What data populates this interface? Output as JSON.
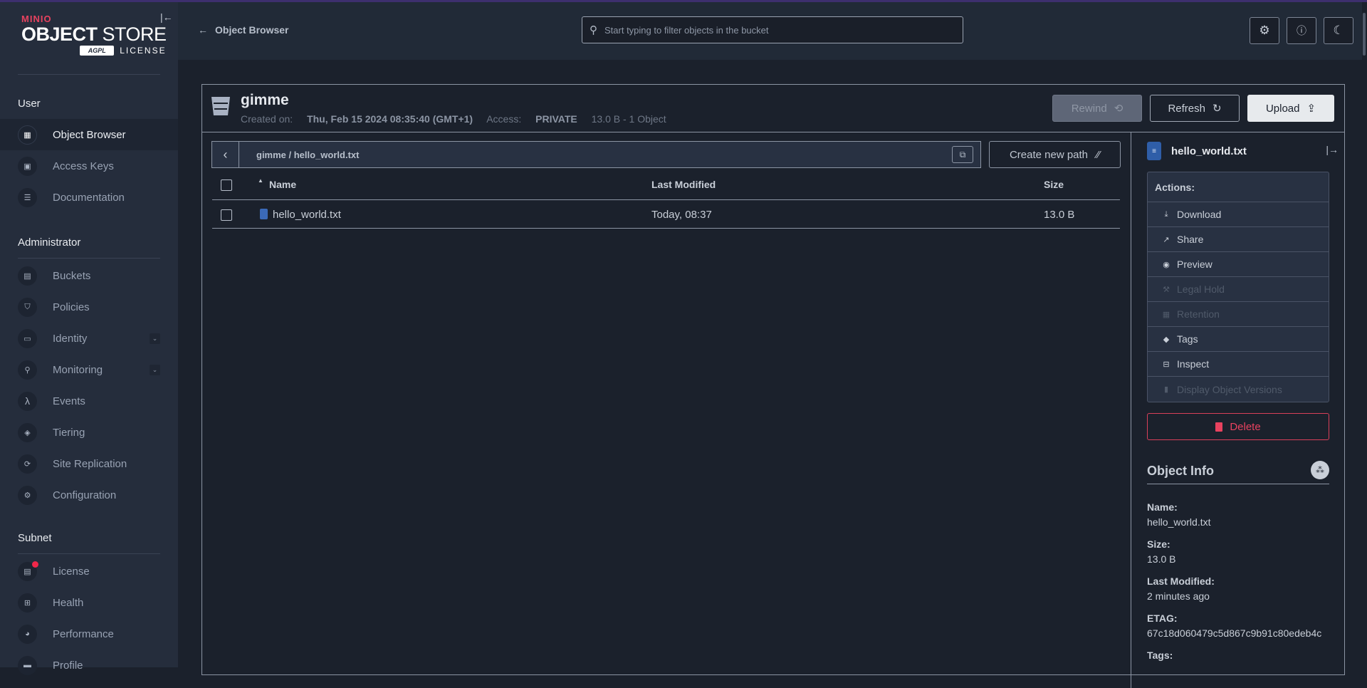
{
  "brand": {
    "minio": "MINIO",
    "product_bold": "OBJECT",
    "product_light": "STORE",
    "agpl": "AGPL",
    "license": "LICENSE"
  },
  "sidebar": {
    "sections": [
      {
        "title": "User",
        "items": [
          {
            "label": "Object Browser",
            "icon": "object-browser-icon",
            "active": true
          },
          {
            "label": "Access Keys",
            "icon": "access-keys-icon"
          },
          {
            "label": "Documentation",
            "icon": "documentation-icon"
          }
        ]
      },
      {
        "title": "Administrator",
        "items": [
          {
            "label": "Buckets",
            "icon": "bucket-icon"
          },
          {
            "label": "Policies",
            "icon": "policies-icon"
          },
          {
            "label": "Identity",
            "icon": "identity-icon",
            "expandable": true
          },
          {
            "label": "Monitoring",
            "icon": "monitoring-icon",
            "expandable": true
          },
          {
            "label": "Events",
            "icon": "lambda-icon"
          },
          {
            "label": "Tiering",
            "icon": "tiering-icon"
          },
          {
            "label": "Site Replication",
            "icon": "site-replication-icon"
          },
          {
            "label": "Configuration",
            "icon": "gear-icon"
          }
        ]
      },
      {
        "title": "Subnet",
        "items": [
          {
            "label": "License",
            "icon": "license-icon",
            "badge": true
          },
          {
            "label": "Health",
            "icon": "health-icon"
          },
          {
            "label": "Performance",
            "icon": "performance-icon"
          },
          {
            "label": "Profile",
            "icon": "profile-icon"
          }
        ]
      }
    ]
  },
  "topbar": {
    "back_label": "Object Browser",
    "search_placeholder": "Start typing to filter objects in the bucket",
    "search_value": ""
  },
  "bucket": {
    "name": "gimme",
    "created_label": "Created on:",
    "created_value": "Thu, Feb 15 2024 08:35:40 (GMT+1)",
    "access_label": "Access:",
    "access_value": "PRIVATE",
    "summary": "13.0 B - 1 Object",
    "buttons": {
      "rewind": "Rewind",
      "refresh": "Refresh",
      "upload": "Upload"
    }
  },
  "browser": {
    "path": "gimme / hello_world.txt",
    "create_path_label": "Create new path",
    "columns": [
      "Name",
      "Last Modified",
      "Size"
    ],
    "rows": [
      {
        "name": "hello_world.txt",
        "modified": "Today, 08:37",
        "size": "13.0 B"
      }
    ]
  },
  "detail": {
    "filename": "hello_world.txt",
    "actions_title": "Actions:",
    "actions": [
      {
        "label": "Download",
        "icon": "download-icon",
        "enabled": true
      },
      {
        "label": "Share",
        "icon": "share-icon",
        "enabled": true
      },
      {
        "label": "Preview",
        "icon": "eye-icon",
        "enabled": true
      },
      {
        "label": "Legal Hold",
        "icon": "gavel-icon",
        "enabled": false
      },
      {
        "label": "Retention",
        "icon": "calendar-icon",
        "enabled": false
      },
      {
        "label": "Tags",
        "icon": "tag-icon",
        "enabled": true
      },
      {
        "label": "Inspect",
        "icon": "inspect-icon",
        "enabled": true
      },
      {
        "label": "Display Object Versions",
        "icon": "versions-icon",
        "enabled": false
      }
    ],
    "delete_label": "Delete",
    "info_title": "Object Info",
    "fields": [
      {
        "key": "Name:",
        "value": "hello_world.txt"
      },
      {
        "key": "Size:",
        "value": "13.0 B"
      },
      {
        "key": "Last Modified:",
        "value": "2 minutes ago"
      },
      {
        "key": "ETAG:",
        "value": "67c18d060479c5d867c9b91c80edeb4c"
      },
      {
        "key": "Tags:",
        "value": ""
      }
    ]
  },
  "colors": {
    "accent_red": "#e8425f",
    "file_blue": "#3b6ab8"
  }
}
